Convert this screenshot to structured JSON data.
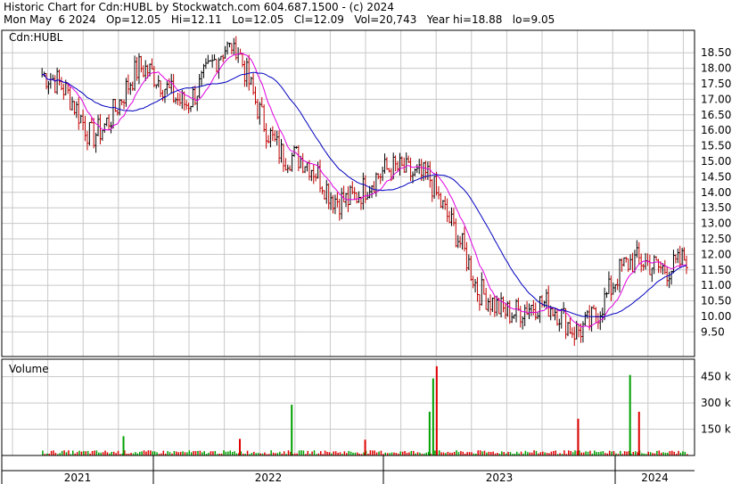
{
  "header": {
    "line1": "Historic Chart for Cdn:HUBL by Stockwatch.com 604.687.1500 - (c) 2024",
    "line2": "Mon May  6 2024   Op=12.05   Hi=12.11   Lo=12.05   Cl=12.09   Vol=20,743   Year hi=18.88   lo=9.05"
  },
  "colors": {
    "up": "#000000",
    "down": "#c00000",
    "ma_short": "#e000e0",
    "ma_long": "#0000c0",
    "vol_up": "#00a000",
    "vol_down": "#e00000",
    "grid": "#c8c8c8",
    "frame": "#000000"
  },
  "chart_data": [
    {
      "type": "line",
      "panel": "price",
      "label": "Cdn:HUBL",
      "ylim": [
        9.05,
        18.88
      ],
      "yticks": [
        "18.50",
        "18.00",
        "17.50",
        "17.00",
        "16.50",
        "16.00",
        "15.50",
        "15.00",
        "14.50",
        "14.00",
        "13.50",
        "13.00",
        "12.50",
        "12.00",
        "11.50",
        "11.00",
        "10.50",
        "10.00",
        "9.50"
      ],
      "x": [
        "2021-01",
        "2021-04",
        "2021-07",
        "2021-10",
        "2022-01",
        "2022-04",
        "2022-07",
        "2022-10",
        "2023-01",
        "2023-04",
        "2023-07",
        "2023-10",
        "2024-01",
        "2024-05"
      ],
      "series": [
        {
          "name": "",
          "values": [
            17.8,
            16.0,
            17.7,
            17.2,
            18.6,
            15.2,
            14.0,
            14.3,
            14.9,
            10.6,
            10.4,
            9.6,
            11.3,
            12.09
          ]
        }
      ],
      "grid": true
    },
    {
      "type": "bar",
      "panel": "volume",
      "label": "Volume",
      "yticks": [
        "450 k",
        "300 k",
        "150 k"
      ],
      "ylim": [
        0,
        550
      ],
      "x": [
        "2021-06",
        "2022-01",
        "2022-04",
        "2022-09",
        "2023-01",
        "2023-01",
        "2023-01",
        "2023-10",
        "2024-01",
        "2024-02"
      ],
      "values": [
        110,
        95,
        290,
        90,
        440,
        510,
        250,
        210,
        460,
        250
      ],
      "grid": true
    }
  ],
  "xaxis": {
    "years": [
      "2021",
      "2022",
      "2023",
      "2024"
    ]
  }
}
